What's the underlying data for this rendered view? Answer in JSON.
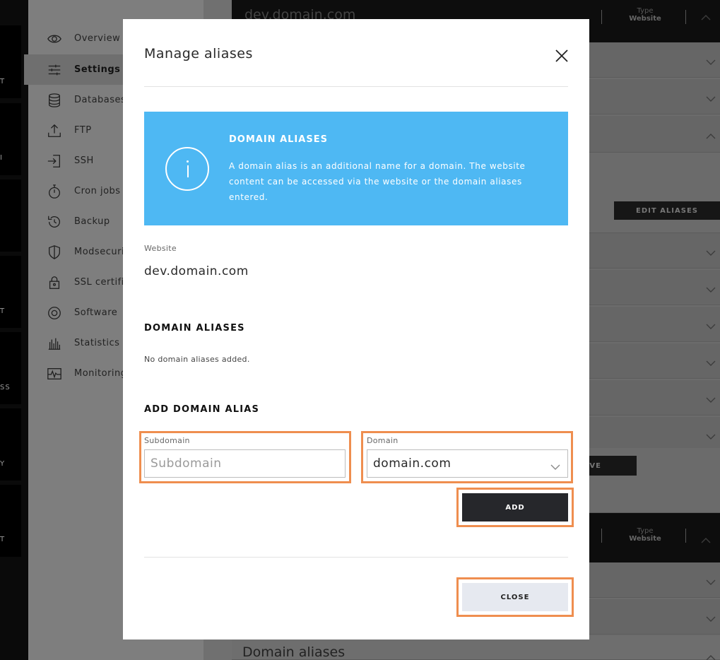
{
  "background": {
    "header_top": {
      "title": "dev.domain.com",
      "type_label": "Type",
      "type_value": "Website"
    },
    "header_bottom": {
      "type_label": "Type",
      "type_value": "Website"
    },
    "edit_aliases_label": "EDIT ALIASES",
    "save_fragment": "VE",
    "bottom_title": "Domain aliases",
    "rail_labels": [
      "T",
      "I",
      "T",
      "SS",
      "Y",
      "T"
    ],
    "sidebar": {
      "items": [
        {
          "label": "Overview",
          "icon": "eye-icon"
        },
        {
          "label": "Settings",
          "icon": "sliders-icon"
        },
        {
          "label": "Databases",
          "icon": "database-icon"
        },
        {
          "label": "FTP",
          "icon": "upload-icon"
        },
        {
          "label": "SSH",
          "icon": "login-icon"
        },
        {
          "label": "Cron jobs",
          "icon": "stopwatch-icon"
        },
        {
          "label": "Backup",
          "icon": "history-icon"
        },
        {
          "label": "Modsecuri",
          "icon": "shield-icon"
        },
        {
          "label": "SSL certifi",
          "icon": "lock-icon"
        },
        {
          "label": "Software",
          "icon": "target-icon"
        },
        {
          "label": "Statistics",
          "icon": "bar-chart-icon"
        },
        {
          "label": "Monitoring",
          "icon": "pulse-icon"
        }
      ]
    }
  },
  "modal": {
    "title": "Manage aliases",
    "info": {
      "title": "DOMAIN ALIASES",
      "text": "A domain alias is an additional name for a domain. The website content can be accessed via the website or the domain aliases entered.",
      "icon": "info-icon"
    },
    "website_label": "Website",
    "website_value": "dev.domain.com",
    "aliases_heading": "DOMAIN ALIASES",
    "no_aliases": "No domain aliases added.",
    "add_heading": "ADD DOMAIN ALIAS",
    "subdomain_label": "Subdomain",
    "subdomain_placeholder": "Subdomain",
    "subdomain_value": "",
    "domain_label": "Domain",
    "domain_selected": "domain.com",
    "add_button": "ADD",
    "close_button": "CLOSE"
  },
  "colors": {
    "info_bg": "#4eb8f3",
    "highlight": "#ef8e4f",
    "add_button_bg": "#26272b",
    "close_button_bg": "#e6e9f0"
  }
}
